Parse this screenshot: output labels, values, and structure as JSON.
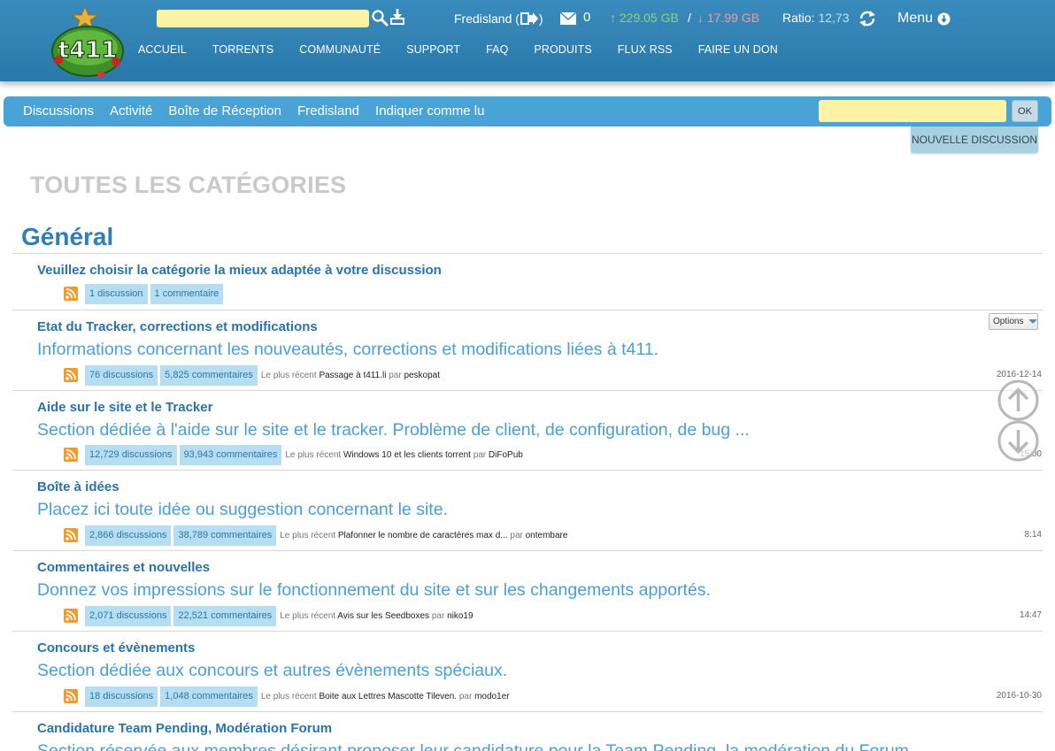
{
  "header": {
    "logo_text": "t411",
    "user": {
      "name": "Fredisland (",
      "close_paren": ")"
    },
    "messages_count": "0",
    "upload": "↑ 229.05 GB",
    "slash": "/",
    "download": "↓ 17.99 GB",
    "ratio_label": "Ratio:",
    "ratio_value": "12,73",
    "menu_label": "Menu",
    "nav": [
      "ACCUEIL",
      "TORRENTS",
      "COMMUNAUTÉ",
      "SUPPORT",
      "FAQ",
      "PRODUITS",
      "FLUX RSS",
      "FAIRE UN DON"
    ],
    "colors": {
      "bar": "#3a8bbd",
      "search_bg": "#fbf2a6",
      "upload": "#8fd17a",
      "download": "#f49a9a"
    }
  },
  "subnav": {
    "links": [
      "Discussions",
      "Activité",
      "Boîte de Réception",
      "Fredisland",
      "Indiquer comme lu"
    ],
    "ok_label": "OK",
    "new_discussion": "NOUVELLE DISCUSSION",
    "color": "#4aa3d6"
  },
  "page_title": "TOUTES LES CATÉGORIES",
  "group_title": "Général",
  "latest_label": "Le plus récent",
  "by_label": "par",
  "options_label": "Options",
  "categories": [
    {
      "name": "Veuillez choisir la catégorie la mieux adaptée à votre discussion",
      "description": "",
      "discussions": "1 discussion",
      "comments": "1 commentaire",
      "latest_title": "",
      "latest_author": "",
      "date": ""
    },
    {
      "name": "Etat du Tracker, corrections et modifications",
      "description": "Informations concernant les nouveautés, corrections et modifications liées à t411.",
      "discussions": "76 discussions",
      "comments": "5,825 commentaires",
      "latest_title": "Passage à t411.li",
      "latest_author": "peskopat",
      "date": "2016-12-14"
    },
    {
      "name": "Aide sur le site et le Tracker",
      "description": "Section dédiée à l'aide sur le site et le tracker. Problème de client, de configuration, de bug ...",
      "discussions": "12,729 discussions",
      "comments": "93,943 commentaires",
      "latest_title": "Windows 10 et les clients torrent",
      "latest_author": "DiFoPub",
      "date": "15:00"
    },
    {
      "name": "Boîte à idées",
      "description": "Placez ici toute idée ou suggestion concernant le site.",
      "discussions": "2,866 discussions",
      "comments": "38,789 commentaires",
      "latest_title": "Plafonner le nombre de caractères max d...",
      "latest_author": "ontembare",
      "date": "8:14"
    },
    {
      "name": "Commentaires et nouvelles",
      "description": "Donnez vos impressions sur le fonctionnement du site et sur les changements apportés.",
      "discussions": "2,071 discussions",
      "comments": "22,521 commentaires",
      "latest_title": "Avis sur les Seedboxes",
      "latest_author": "niko19",
      "date": "14:47"
    },
    {
      "name": "Concours et évènements",
      "description": "Section dédiée aux concours et autres évènements spéciaux.",
      "discussions": "18 discussions",
      "comments": "1,048 commentaires",
      "latest_title": "Boite aux Lettres Mascotte Tileven.",
      "latest_author": "modo1er",
      "date": "2016-10-30"
    },
    {
      "name": "Candidature Team Pending, Modération Forum",
      "description": "Section réservée aux membres désirant proposer leur candidature pour la Team Pending, la modération du Forum",
      "discussions": "",
      "comments": "",
      "latest_title": "",
      "latest_author": "",
      "date": ""
    }
  ]
}
